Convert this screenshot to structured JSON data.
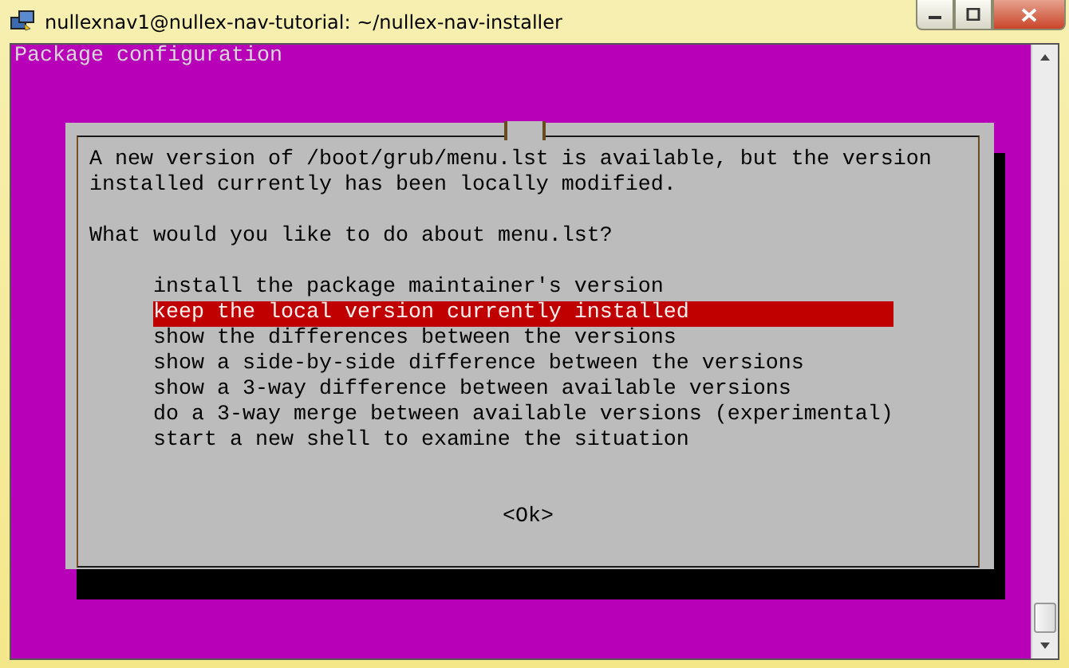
{
  "window": {
    "title": "nullexnav1@nullex-nav-tutorial: ~/nullex-nav-installer"
  },
  "terminal": {
    "header": "Package configuration",
    "dialog": {
      "message": "A new version of /boot/grub/menu.lst is available, but the version installed currently has been locally modified.",
      "question": "What would you like to do about menu.lst?",
      "options": [
        {
          "label": "install the package maintainer's version",
          "selected": false
        },
        {
          "label": "keep the local version currently installed",
          "selected": true
        },
        {
          "label": "show the differences between the versions",
          "selected": false
        },
        {
          "label": "show a side-by-side difference between the versions",
          "selected": false
        },
        {
          "label": "show a 3-way difference between available versions",
          "selected": false
        },
        {
          "label": "do a 3-way merge between available versions (experimental)",
          "selected": false
        },
        {
          "label": "start a new shell to examine the situation",
          "selected": false
        }
      ],
      "button": "<Ok>"
    }
  }
}
